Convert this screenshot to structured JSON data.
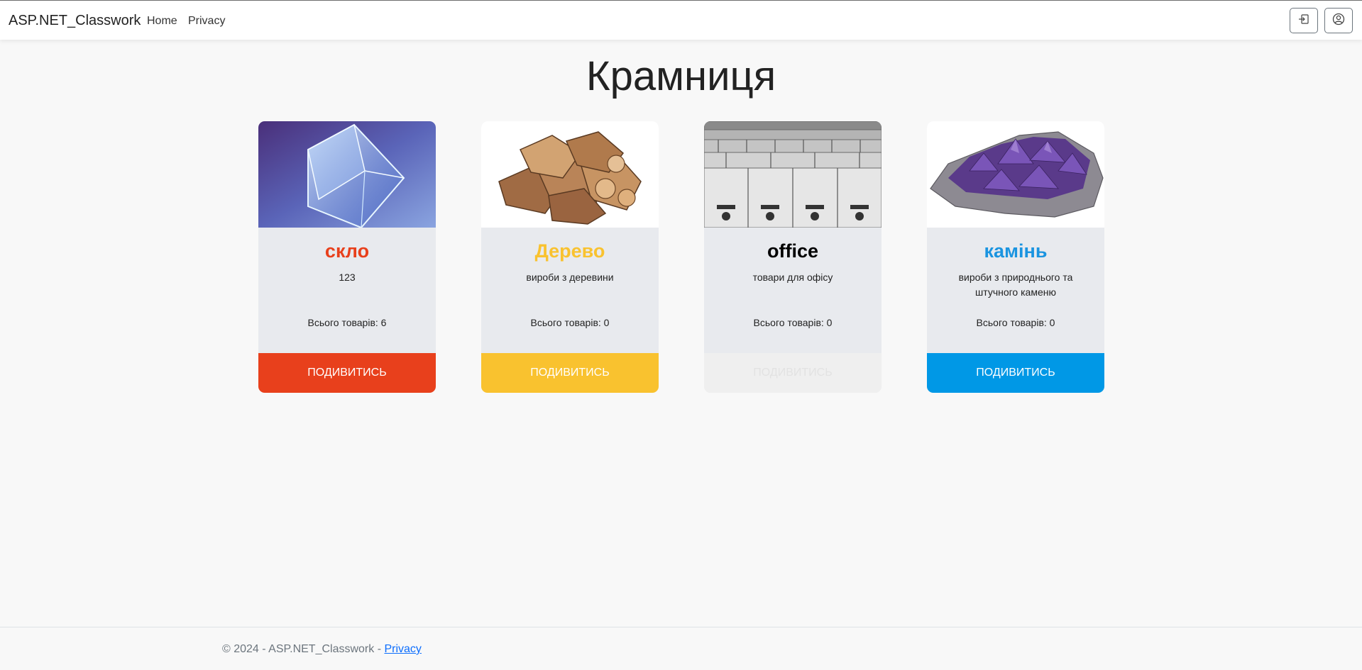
{
  "navbar": {
    "brand": "ASP.NET_Classwork",
    "links": [
      "Home",
      "Privacy"
    ],
    "login_icon": "login-icon",
    "user_icon": "user-icon"
  },
  "main": {
    "title": "Крамниця",
    "cards": [
      {
        "title": "скло",
        "description": "123",
        "count_text": "Всього товарів: 6",
        "button": "ПОДИВИТИСЬ",
        "accent": "#e8401c",
        "image": "glass-cube-image"
      },
      {
        "title": "Дерево",
        "description": "вироби з деревини",
        "count_text": "Всього товарів: 0",
        "button": "ПОДИВИТИСЬ",
        "accent": "#f9c22f",
        "image": "firewood-image"
      },
      {
        "title": "office",
        "description": "товари для офісу",
        "count_text": "Всього товарів: 0",
        "button": "ПОДИВИТИСЬ",
        "accent": "#000000",
        "image": "office-cubicles-image"
      },
      {
        "title": "камінь",
        "description": "вироби з природнього та штучного каменю",
        "count_text": "Всього товарів: 0",
        "button": "ПОДИВИТИСЬ",
        "accent": "#1a94e0",
        "image": "amethyst-stone-image"
      }
    ]
  },
  "footer": {
    "text": "© 2024 - ASP.NET_Classwork - ",
    "link": "Privacy"
  }
}
